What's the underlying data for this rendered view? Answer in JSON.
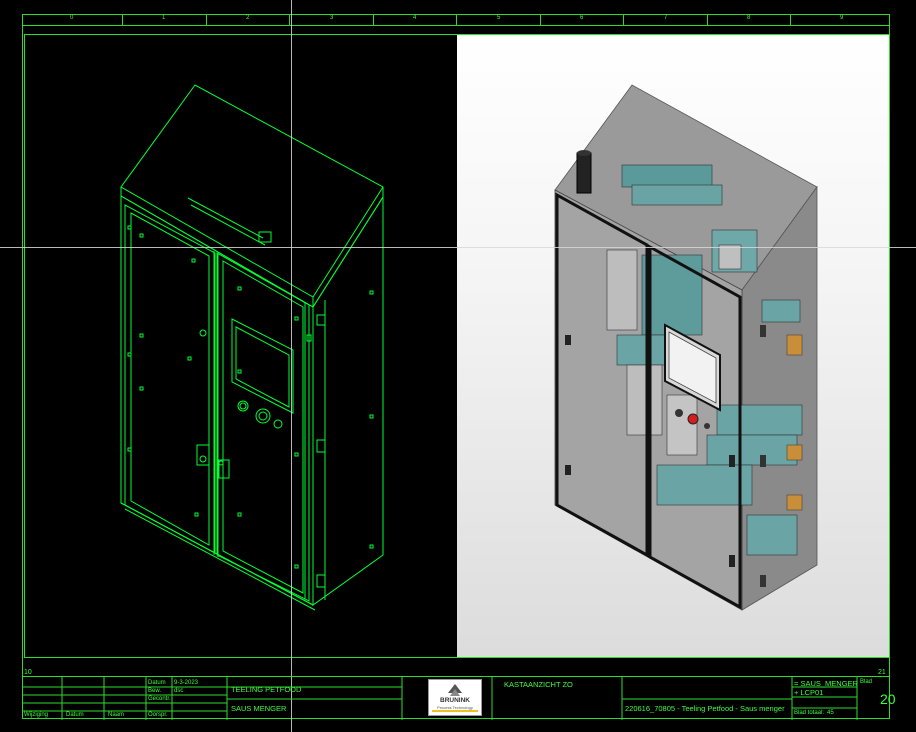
{
  "ruler": [
    "0",
    "1",
    "2",
    "3",
    "4",
    "5",
    "6",
    "7",
    "8",
    "9"
  ],
  "edge": {
    "left": "10",
    "right": "21"
  },
  "titleblock": {
    "col_headers": [
      "Wijziging",
      "Datum",
      "Naam"
    ],
    "row_labels": [
      "Datum",
      "Bew.",
      "Gecontr.",
      "Oorspr."
    ],
    "date_value": "9-3-2023",
    "bew_value": "dsc",
    "client": "TEELING PETFOOD",
    "project": "SAUS MENGER",
    "logo_name": "BRUNINK",
    "logo_tagline": "Process Technology",
    "view_title": "KASTAANZICHT ZO",
    "drawing_ref": "220616_70805 - Teeling Petfood - Saus menger",
    "designation": "= SAUS_MENGER",
    "location": "+ LCP01",
    "sheet_label": "Blad",
    "sheet_number": "20",
    "sheet_total_label": "Blad totaal:",
    "sheet_total": "45"
  },
  "colors": {
    "line": "#3cff3c",
    "panel": "#00ff33",
    "background": "#000000"
  },
  "icons": {
    "logo": "brunink-logo"
  }
}
